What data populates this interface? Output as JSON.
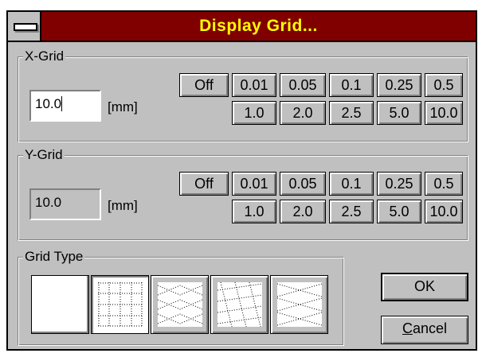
{
  "title": "Display Grid...",
  "x_grid": {
    "legend": "X-Grid",
    "value": "10.0",
    "unit": "[mm]",
    "off_label": "Off",
    "row1": [
      "0.01",
      "0.05",
      "0.1",
      "0.25",
      "0.5"
    ],
    "row2": [
      "1.0",
      "2.0",
      "2.5",
      "5.0",
      "10.0"
    ]
  },
  "y_grid": {
    "legend": "Y-Grid",
    "value": "10.0",
    "unit": "[mm]",
    "off_label": "Off",
    "row1": [
      "0.01",
      "0.05",
      "0.1",
      "0.25",
      "0.5"
    ],
    "row2": [
      "1.0",
      "2.0",
      "2.5",
      "5.0",
      "10.0"
    ]
  },
  "grid_type": {
    "legend": "Grid Type",
    "options": [
      "blank",
      "rectangular-grid",
      "diamond-grid",
      "skewed-grid",
      "diagonal-grid"
    ],
    "selected": "rectangular-grid"
  },
  "buttons": {
    "ok_label": "OK",
    "cancel_label": "Cancel"
  },
  "colors": {
    "titlebar": "#800000",
    "title_text": "#ffff00",
    "face": "#c0c0c0"
  }
}
